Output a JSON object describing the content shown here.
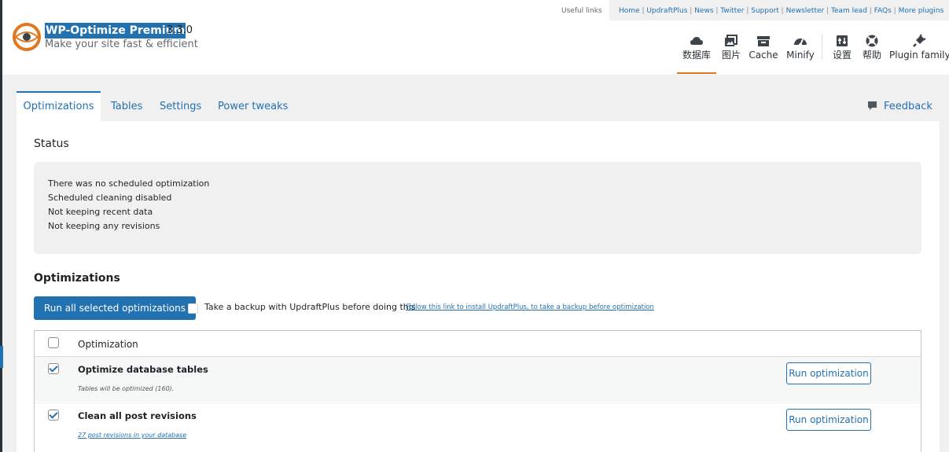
{
  "brand": {
    "name": "WP-Optimize Premium",
    "version": "3.3.0",
    "tagline": "Make your site fast & efficient"
  },
  "useful_links": {
    "label": "Useful links",
    "links": [
      "Home",
      "UpdraftPlus",
      "News",
      "Twitter",
      "Support",
      "Newsletter",
      "Team lead",
      "FAQs",
      "More plugins"
    ]
  },
  "top_nav": [
    {
      "label": "数据库",
      "icon": "cloud-database-icon",
      "active": true
    },
    {
      "label": "图片",
      "icon": "images-icon"
    },
    {
      "label": "Cache",
      "icon": "archive-box-icon"
    },
    {
      "label": "Minify",
      "icon": "dashboard-gauge-icon"
    },
    {
      "label": "设置",
      "icon": "settings-sliders-icon"
    },
    {
      "label": "帮助",
      "icon": "lifebuoy-icon"
    },
    {
      "label": "Plugin family",
      "icon": "plugin-plug-icon"
    }
  ],
  "tabs": {
    "items": [
      "Optimizations",
      "Tables",
      "Settings",
      "Power tweaks"
    ],
    "feedback": "Feedback"
  },
  "status": {
    "heading": "Status",
    "lines": [
      "There was no scheduled optimization",
      "Scheduled cleaning disabled",
      "Not keeping recent data",
      "Not keeping any revisions"
    ]
  },
  "optimizations": {
    "heading": "Optimizations",
    "run_all_label": "Run all selected optimizations",
    "backup_label": "Take a backup with UpdraftPlus before doing this",
    "backup_link": "Follow this link to install UpdraftPlus, to take a backup before optimization",
    "table_header": "Optimization",
    "rows": [
      {
        "title": "Optimize database tables",
        "subtitle": "Tables will be optimized (160).",
        "checked": true,
        "button": "Run optimization"
      },
      {
        "title": "Clean all post revisions",
        "subtitle": "27 post revisions in your database",
        "checked": true,
        "button": "Run optimization"
      }
    ]
  },
  "colors": {
    "accent": "#2271b1",
    "active_underline": "#e0781f",
    "logo_orange": "#e0781f"
  }
}
